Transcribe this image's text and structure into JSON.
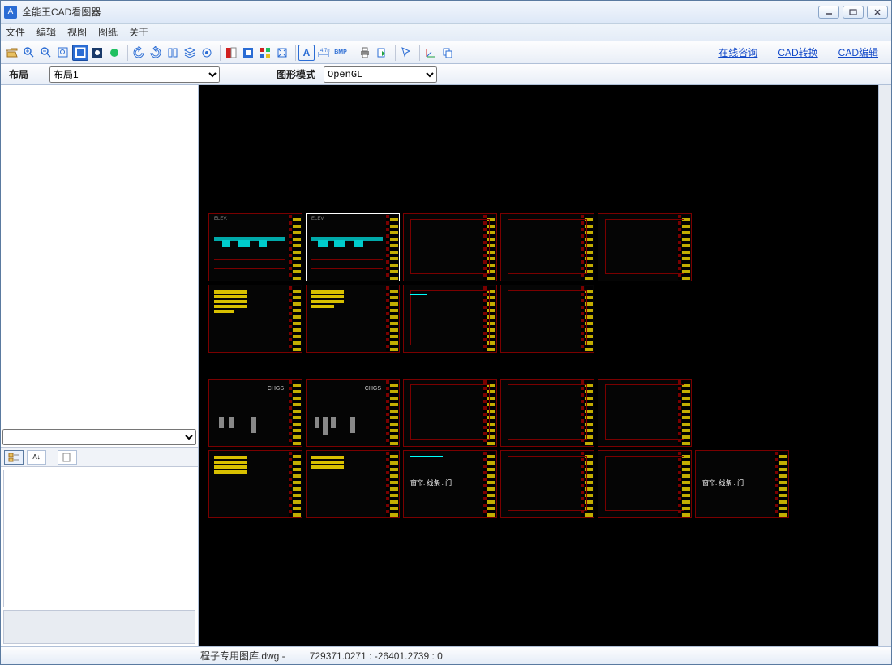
{
  "window": {
    "title": "全能王CAD看图器"
  },
  "menu": {
    "file": "文件",
    "edit": "编辑",
    "view": "视图",
    "drawings": "图纸",
    "about": "关于"
  },
  "toolbar_links": {
    "consult": "在线咨询",
    "convert": "CAD转换",
    "edit": "CAD编辑"
  },
  "layoutbar": {
    "layout_label": "布局",
    "layout_value": "布局1",
    "mode_label": "图形模式",
    "mode_value": "OpenGL"
  },
  "thumbs": {
    "chgs": "CHGS",
    "curtain_label": "窗帘. 线条 . 门"
  },
  "status": {
    "filename": "程子专用图库.dwg -",
    "coords": "729371.0271 : -26401.2739 : 0"
  },
  "icons": {
    "open": "open",
    "zoomin": "zoom-in",
    "zoomout": "zoom-out",
    "zoomwin": "zoom-window",
    "fit": "fit",
    "pan": "pan",
    "bg": "bg-color",
    "rot1": "rotate",
    "rot2": "rotate",
    "layers": "layers",
    "layer2": "layer-states",
    "swatch": "swatch",
    "props": "props",
    "sel1": "sel",
    "sel2": "sel",
    "sel3": "sel",
    "text": "text-tool",
    "dim": "dimension",
    "bmp": "bmp-export",
    "print": "print",
    "export": "export",
    "arrow": "arrow",
    "axes": "axes",
    "copy": "copy"
  }
}
